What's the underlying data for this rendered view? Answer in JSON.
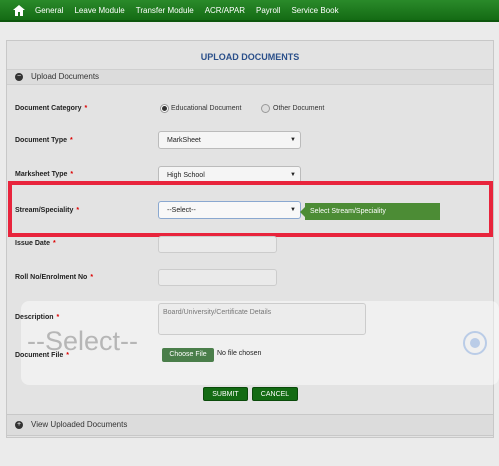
{
  "nav": {
    "items": [
      "General",
      "Leave Module",
      "Transfer Module",
      "ACR/APAR",
      "Payroll",
      "Service Book"
    ]
  },
  "panel": {
    "title": "UPLOAD DOCUMENTS",
    "section_title": "Upload Documents",
    "footer_section": "View Uploaded Documents"
  },
  "form": {
    "required_mark": "*",
    "document_category": {
      "label": "Document Category",
      "options": [
        "Educational Document",
        "Other Document"
      ],
      "selected": "Educational Document"
    },
    "document_type": {
      "label": "Document Type",
      "value": "MarkSheet"
    },
    "marksheet_type": {
      "label": "Marksheet Type",
      "value": "High School"
    },
    "stream": {
      "label": "Stream/Speciality",
      "value": "--Select--",
      "tooltip": "Select Stream/Speciality"
    },
    "issue_date": {
      "label": "Issue Date"
    },
    "roll_no": {
      "label": "Roll No/Enrolment No"
    },
    "description": {
      "label": "Description",
      "placeholder": "Board/University/Certificate Details"
    },
    "document_file": {
      "label": "Document File",
      "button": "Choose File",
      "status": "No file chosen"
    },
    "submit_label": "SUBMIT",
    "cancel_label": "CANCEL"
  },
  "overlay": {
    "ghost_text": "--Select--"
  },
  "colors": {
    "nav_green": "#146b14",
    "highlight_red": "#e8243c",
    "tooltip_green": "#4c8c35",
    "title_blue": "#2a4f8a"
  }
}
